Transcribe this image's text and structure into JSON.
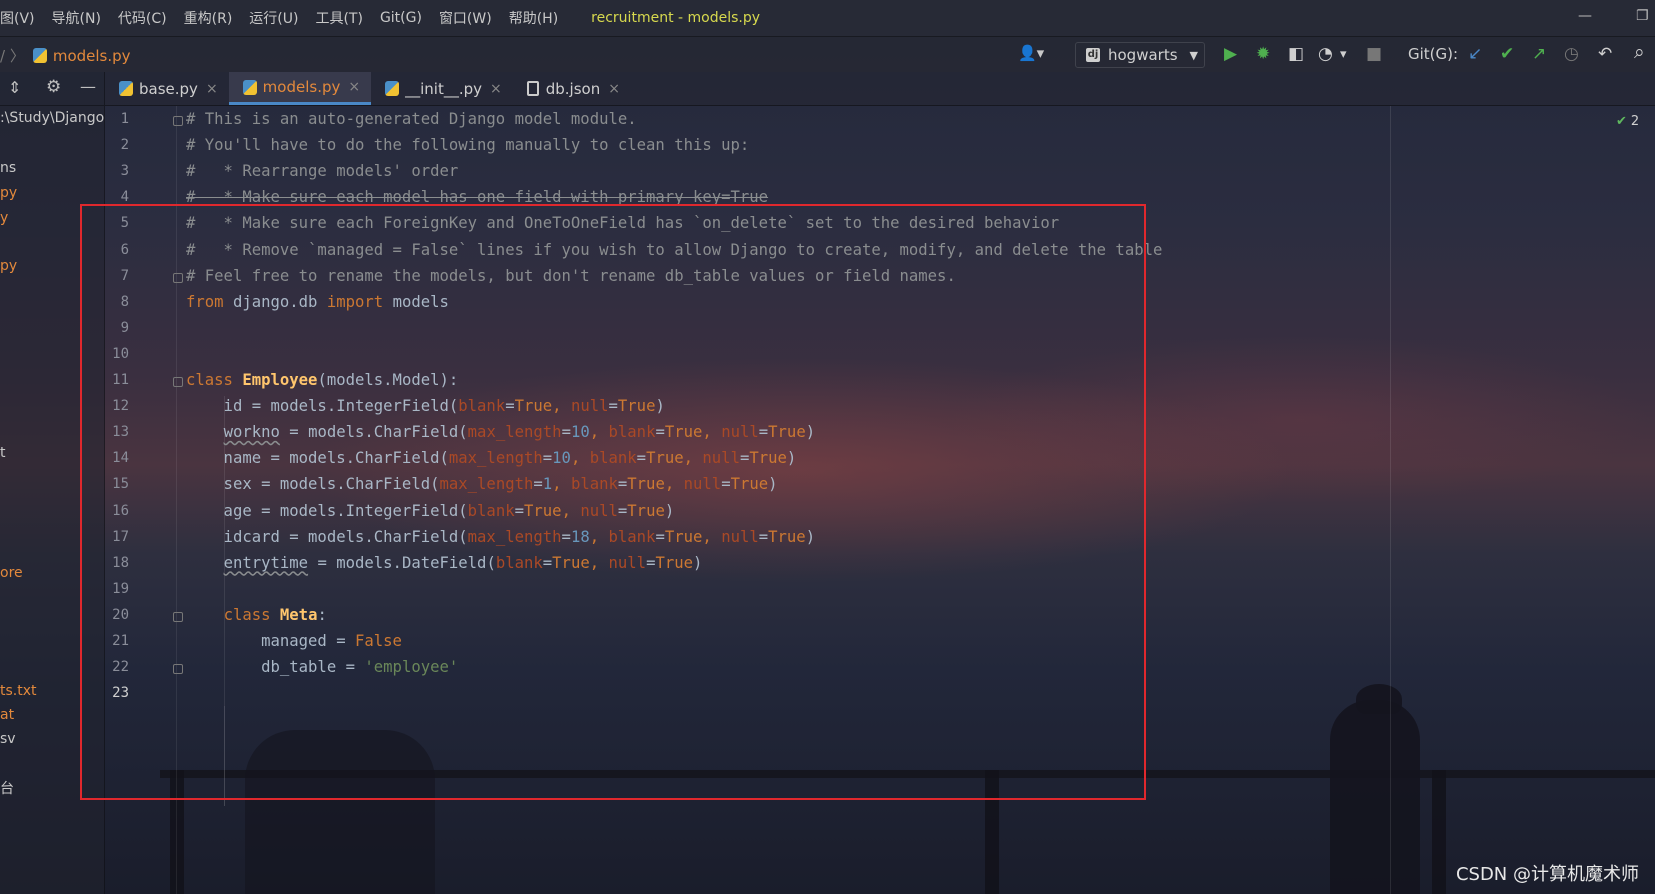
{
  "window_title": "recruitment - models.py",
  "menu": [
    "图(V)",
    "导航(N)",
    "代码(C)",
    "重构(R)",
    "运行(U)",
    "工具(T)",
    "Git(G)",
    "窗口(W)",
    "帮助(H)"
  ],
  "window_controls": {
    "minimize": "—",
    "maximize": "❐"
  },
  "breadcrumb": {
    "separator": "/ 〉",
    "file": "models.py"
  },
  "toolbar": {
    "user_icon": "👤▾",
    "run_config": "hogwarts",
    "run_config_badge": "dj",
    "run_config_arrow": "▼",
    "run": "▶",
    "debug": "✹",
    "coverage": "◧",
    "profile": "◔",
    "profile_arrow": "▾",
    "stop": "■",
    "git_label": "Git(G):",
    "git_update": "↙",
    "git_commit": "✔",
    "git_push": "↗",
    "git_history": "◷",
    "git_rollback": "↶",
    "search": "⌕"
  },
  "project_panel": {
    "collapse_icon": "⇕",
    "settings_icon": "⚙",
    "hide_icon": "—",
    "items": [
      {
        "label": ":\\Study\\Django",
        "color": "#c8c8c8"
      },
      {
        "label": "ns",
        "color": "#c8c8c8"
      },
      {
        "label": "py",
        "color": "#e3893c"
      },
      {
        "label": "y",
        "color": "#e3893c"
      },
      {
        "label": "py",
        "color": "#e3893c"
      },
      {
        "label": "t",
        "color": "#c8c8c8"
      },
      {
        "label": "ore",
        "color": "#e3893c"
      },
      {
        "label": "ts.txt",
        "color": "#e3893c"
      },
      {
        "label": "at",
        "color": "#e3893c"
      },
      {
        "label": "sv",
        "color": "#c8c8c8"
      },
      {
        "label": "台",
        "color": "#c8c8c8"
      }
    ]
  },
  "tabs": [
    {
      "label": "base.py",
      "icon": "py",
      "active": false
    },
    {
      "label": "models.py",
      "icon": "py",
      "active": true
    },
    {
      "label": "__init__.py",
      "icon": "py",
      "active": false
    },
    {
      "label": "db.json",
      "icon": "json",
      "active": false
    }
  ],
  "tab_close": "×",
  "line_numbers": [
    "1",
    "2",
    "3",
    "4",
    "5",
    "6",
    "7",
    "8",
    "9",
    "10",
    "11",
    "12",
    "13",
    "14",
    "15",
    "16",
    "17",
    "18",
    "19",
    "20",
    "21",
    "22",
    "23"
  ],
  "code_lines": [
    [
      {
        "t": "# This is an auto-generated Django model module.",
        "c": "cm"
      }
    ],
    [
      {
        "t": "# You'll have to do the following manually to clean this up:",
        "c": "cm"
      }
    ],
    [
      {
        "t": "#   * Rearrange models' order",
        "c": "cm"
      }
    ],
    [
      {
        "t": "#   * Make sure each model has one field with primary_key=True",
        "c": "cm strike"
      }
    ],
    [
      {
        "t": "#   * Make sure each ForeignKey and OneToOneField has `on_delete` set to the desired behavior",
        "c": "cm"
      }
    ],
    [
      {
        "t": "#   * Remove `managed = False` lines if you wish to allow Django to create, modify, and delete the table",
        "c": "cm"
      }
    ],
    [
      {
        "t": "# Feel free to rename the models, but don't rename db_table values or field names.",
        "c": "cm"
      }
    ],
    [
      {
        "t": "from",
        "c": "kw"
      },
      {
        "t": " django.db ",
        "c": ""
      },
      {
        "t": "import",
        "c": "kw"
      },
      {
        "t": " models",
        "c": ""
      }
    ],
    [],
    [],
    [
      {
        "t": "class ",
        "c": "kw"
      },
      {
        "t": "Employee",
        "c": "cls"
      },
      {
        "t": "(models.Model):",
        "c": ""
      }
    ],
    [
      {
        "t": "    id = models.IntegerField(",
        "c": ""
      },
      {
        "t": "blank",
        "c": "pr"
      },
      {
        "t": "=",
        "c": ""
      },
      {
        "t": "True",
        "c": "bi"
      },
      {
        "t": ", ",
        "c": "kw"
      },
      {
        "t": "null",
        "c": "pr"
      },
      {
        "t": "=",
        "c": ""
      },
      {
        "t": "True",
        "c": "bi"
      },
      {
        "t": ")",
        "c": ""
      }
    ],
    [
      {
        "t": "    ",
        "c": ""
      },
      {
        "t": "workno",
        "c": "squig"
      },
      {
        "t": " = models.CharField(",
        "c": ""
      },
      {
        "t": "max_length",
        "c": "pr"
      },
      {
        "t": "=",
        "c": ""
      },
      {
        "t": "10",
        "c": "num"
      },
      {
        "t": ", ",
        "c": "kw"
      },
      {
        "t": "blank",
        "c": "pr"
      },
      {
        "t": "=",
        "c": ""
      },
      {
        "t": "True",
        "c": "bi"
      },
      {
        "t": ", ",
        "c": "kw"
      },
      {
        "t": "null",
        "c": "pr"
      },
      {
        "t": "=",
        "c": ""
      },
      {
        "t": "True",
        "c": "bi"
      },
      {
        "t": ")",
        "c": ""
      }
    ],
    [
      {
        "t": "    name = models.CharField(",
        "c": ""
      },
      {
        "t": "max_length",
        "c": "pr"
      },
      {
        "t": "=",
        "c": ""
      },
      {
        "t": "10",
        "c": "num"
      },
      {
        "t": ", ",
        "c": "kw"
      },
      {
        "t": "blank",
        "c": "pr"
      },
      {
        "t": "=",
        "c": ""
      },
      {
        "t": "True",
        "c": "bi"
      },
      {
        "t": ", ",
        "c": "kw"
      },
      {
        "t": "null",
        "c": "pr"
      },
      {
        "t": "=",
        "c": ""
      },
      {
        "t": "True",
        "c": "bi"
      },
      {
        "t": ")",
        "c": ""
      }
    ],
    [
      {
        "t": "    sex = models.CharField(",
        "c": ""
      },
      {
        "t": "max_length",
        "c": "pr"
      },
      {
        "t": "=",
        "c": ""
      },
      {
        "t": "1",
        "c": "num"
      },
      {
        "t": ", ",
        "c": "kw"
      },
      {
        "t": "blank",
        "c": "pr"
      },
      {
        "t": "=",
        "c": ""
      },
      {
        "t": "True",
        "c": "bi"
      },
      {
        "t": ", ",
        "c": "kw"
      },
      {
        "t": "null",
        "c": "pr"
      },
      {
        "t": "=",
        "c": ""
      },
      {
        "t": "True",
        "c": "bi"
      },
      {
        "t": ")",
        "c": ""
      }
    ],
    [
      {
        "t": "    age = models.IntegerField(",
        "c": ""
      },
      {
        "t": "blank",
        "c": "pr"
      },
      {
        "t": "=",
        "c": ""
      },
      {
        "t": "True",
        "c": "bi"
      },
      {
        "t": ", ",
        "c": "kw"
      },
      {
        "t": "null",
        "c": "pr"
      },
      {
        "t": "=",
        "c": ""
      },
      {
        "t": "True",
        "c": "bi"
      },
      {
        "t": ")",
        "c": ""
      }
    ],
    [
      {
        "t": "    idcard = models.CharField(",
        "c": ""
      },
      {
        "t": "max_length",
        "c": "pr"
      },
      {
        "t": "=",
        "c": ""
      },
      {
        "t": "18",
        "c": "num"
      },
      {
        "t": ", ",
        "c": "kw"
      },
      {
        "t": "blank",
        "c": "pr"
      },
      {
        "t": "=",
        "c": ""
      },
      {
        "t": "True",
        "c": "bi"
      },
      {
        "t": ", ",
        "c": "kw"
      },
      {
        "t": "null",
        "c": "pr"
      },
      {
        "t": "=",
        "c": ""
      },
      {
        "t": "True",
        "c": "bi"
      },
      {
        "t": ")",
        "c": ""
      }
    ],
    [
      {
        "t": "    ",
        "c": ""
      },
      {
        "t": "entrytime",
        "c": "squig"
      },
      {
        "t": " = models.DateField(",
        "c": ""
      },
      {
        "t": "blank",
        "c": "pr"
      },
      {
        "t": "=",
        "c": ""
      },
      {
        "t": "True",
        "c": "bi"
      },
      {
        "t": ", ",
        "c": "kw"
      },
      {
        "t": "null",
        "c": "pr"
      },
      {
        "t": "=",
        "c": ""
      },
      {
        "t": "True",
        "c": "bi"
      },
      {
        "t": ")",
        "c": ""
      }
    ],
    [],
    [
      {
        "t": "    ",
        "c": ""
      },
      {
        "t": "class ",
        "c": "kw"
      },
      {
        "t": "Meta",
        "c": "cls"
      },
      {
        "t": ":",
        "c": ""
      }
    ],
    [
      {
        "t": "        managed = ",
        "c": ""
      },
      {
        "t": "False",
        "c": "bi"
      }
    ],
    [
      {
        "t": "        db_table = ",
        "c": ""
      },
      {
        "t": "'employee'",
        "c": "str"
      }
    ],
    []
  ],
  "inspection": {
    "icon": "✔",
    "count": "2"
  },
  "watermark": "CSDN @计算机魔术师",
  "colors": {
    "accent_blue": "#4a88c7",
    "file_orange": "#e3893c",
    "title_yellow": "#d7d94e",
    "annotation_red": "#e0282d"
  }
}
